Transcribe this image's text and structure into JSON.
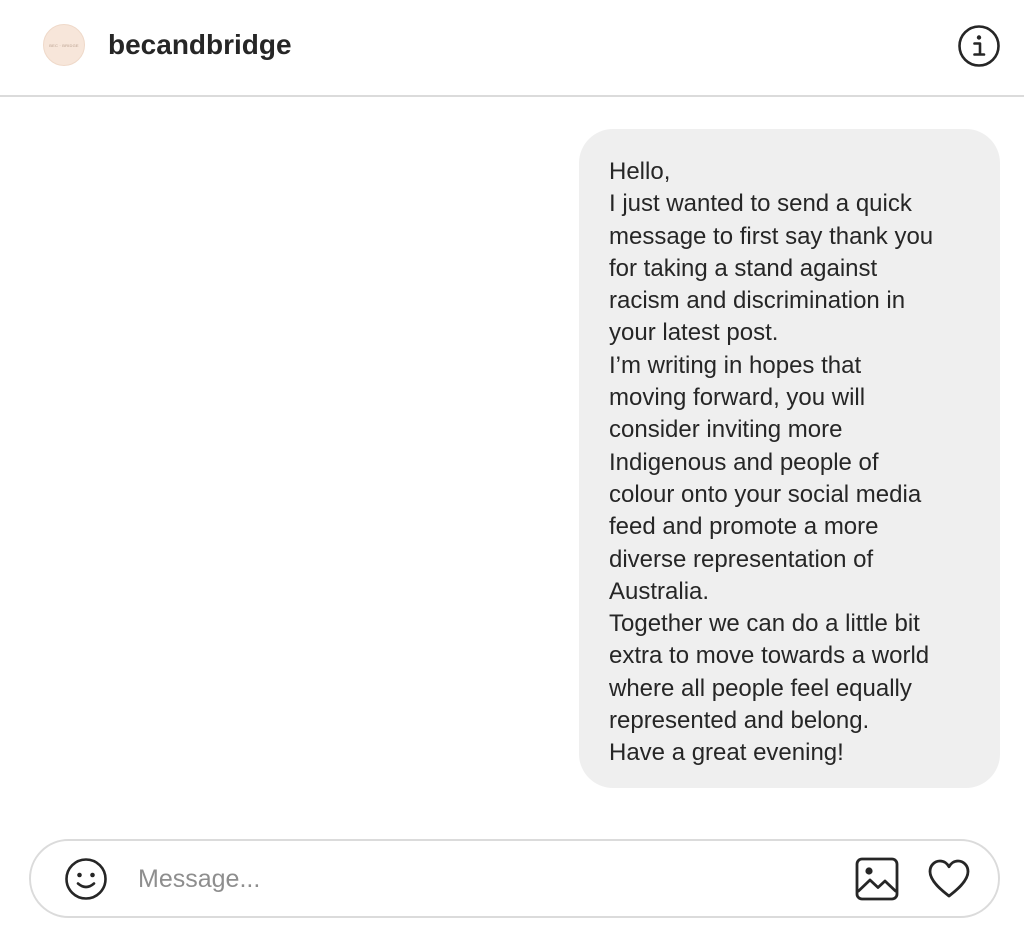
{
  "header": {
    "username": "becandbridge",
    "avatar_text": "BEC · BRIDGE",
    "info_icon": "info-icon"
  },
  "thread": {
    "messages": [
      {
        "direction": "outgoing",
        "text": "Hello,\nI just wanted to send a quick\nmessage to first say thank you\nfor taking a stand against\nracism and discrimination in\nyour latest post.\nI’m writing in hopes that\nmoving forward, you will\nconsider inviting more\nIndigenous and people of\ncolour onto your social media\nfeed and promote a more\ndiverse representation of\nAustralia.\nTogether we can do a little bit\nextra to move towards a world\nwhere all people feel equally\nrepresented and belong.\nHave a great evening!"
      }
    ]
  },
  "composer": {
    "placeholder": "Message...",
    "value": "",
    "emoji_icon": "smiley-icon",
    "image_icon": "image-icon",
    "like_icon": "heart-icon"
  },
  "colors": {
    "text": "#262626",
    "bubble": "#efefef",
    "border": "#dbdbdb",
    "placeholder": "#8e8e8e",
    "avatar_bg": "#f7e6da"
  }
}
